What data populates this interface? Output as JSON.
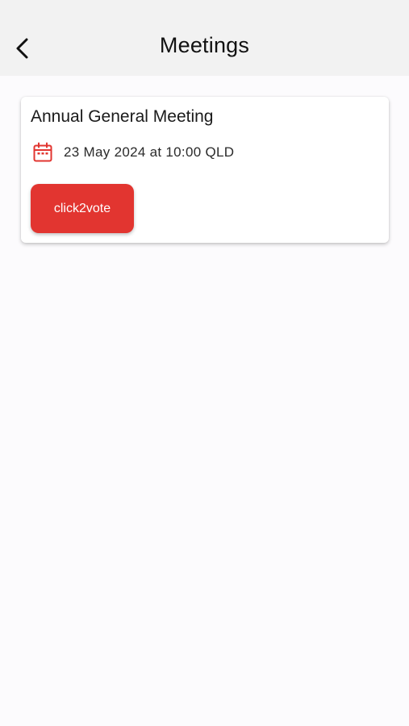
{
  "header": {
    "title": "Meetings",
    "back_icon": "chevron-left-icon"
  },
  "meetings": [
    {
      "title": "Annual General Meeting",
      "date_icon": "calendar-icon",
      "date": "23 May 2024 at 10:00 QLD",
      "button_label": "click2vote"
    }
  ],
  "colors": {
    "accent": "#e23530",
    "header_bg": "#f2f2f2",
    "page_bg": "#fcfbfd"
  }
}
